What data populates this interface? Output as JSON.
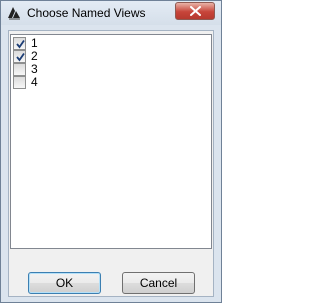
{
  "window": {
    "title": "Choose Named Views",
    "app_icon": "app-logo-icon",
    "close_icon": "close-icon"
  },
  "views": [
    {
      "label": "1",
      "checked": true
    },
    {
      "label": "2",
      "checked": true
    },
    {
      "label": "3",
      "checked": false
    },
    {
      "label": "4",
      "checked": false
    }
  ],
  "buttons": {
    "ok": "OK",
    "cancel": "Cancel"
  },
  "colors": {
    "close_button": "#c7453a",
    "check_mark": "#1c3d75"
  }
}
